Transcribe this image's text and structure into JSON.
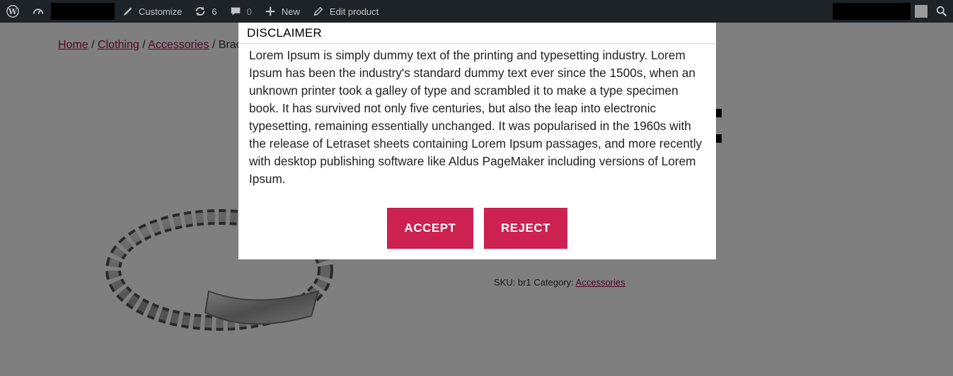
{
  "adminbar": {
    "customize_label": "Customize",
    "updates_count": "6",
    "comments_count": "0",
    "new_label": "New",
    "edit_label": "Edit product"
  },
  "breadcrumb": {
    "home": "Home",
    "clothing": "Clothing",
    "accessories": "Accessories",
    "current": "Brace"
  },
  "product": {
    "sku_label": "SKU:",
    "sku_value": "br1",
    "category_label": "Category:",
    "category_value": "Accessories"
  },
  "modal": {
    "title": "DISCLAIMER",
    "body": "Lorem Ipsum is simply dummy text of the printing and typesetting industry. Lorem Ipsum has been the industry's standard dummy text ever since the 1500s, when an unknown printer took a galley of type and scrambled it to make a type specimen book. It has survived not only five centuries, but also the leap into electronic typesetting, remaining essentially unchanged. It was popularised in the 1960s with the release of Letraset sheets containing Lorem Ipsum passages, and more recently with desktop publishing software like Aldus PageMaker including versions of Lorem Ipsum.",
    "accept_label": "ACCEPT",
    "reject_label": "REJECT"
  },
  "colors": {
    "accent": "#cc2151",
    "adminbar_bg": "#1d2327",
    "link": "#a0104a"
  }
}
